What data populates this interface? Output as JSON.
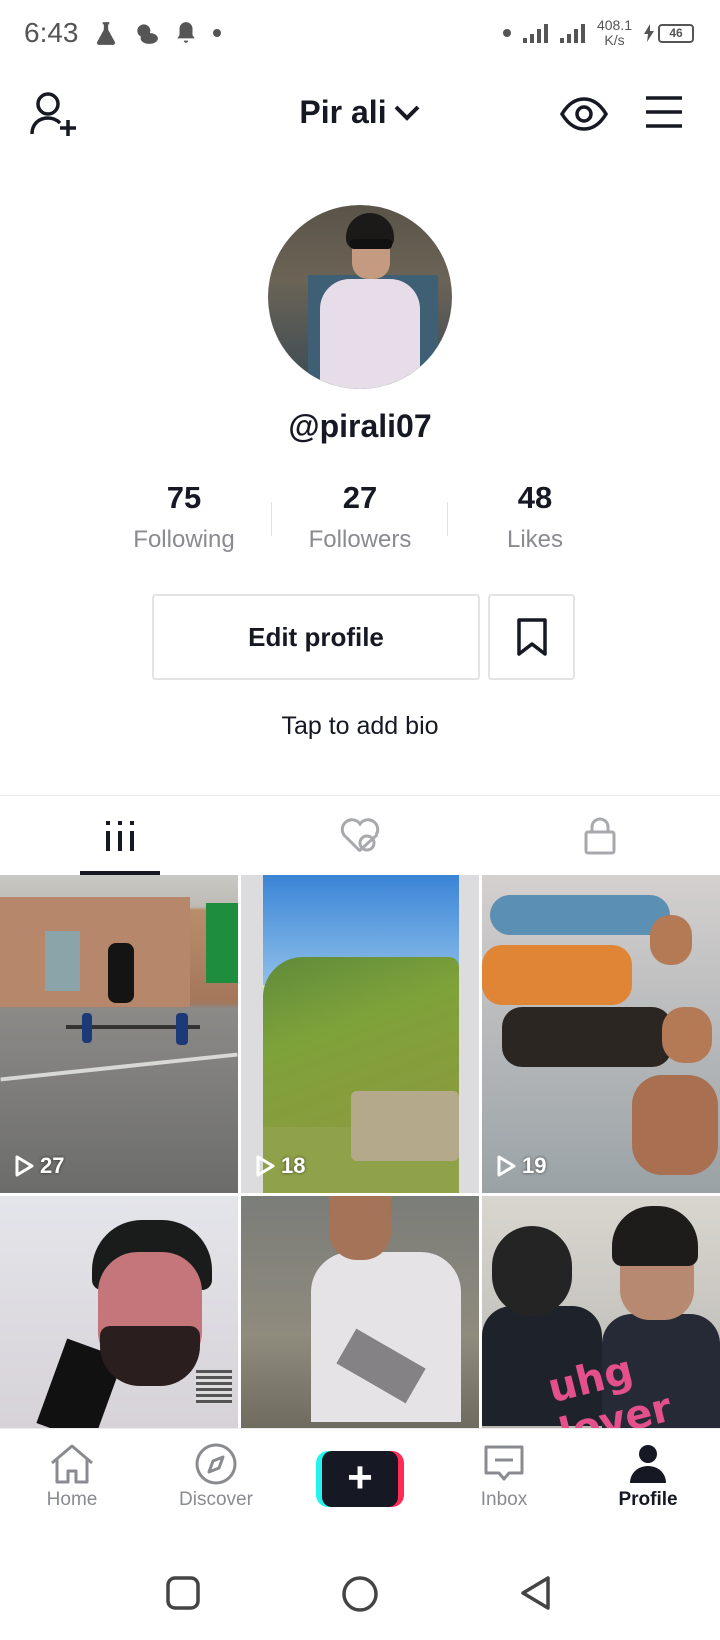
{
  "status_bar": {
    "time": "6:43",
    "net_speed_value": "408.1",
    "net_speed_unit": "K/s",
    "battery": "46"
  },
  "header": {
    "title": "Pir ali"
  },
  "profile": {
    "username": "@pirali07",
    "bio_placeholder": "Tap to add bio"
  },
  "stats": [
    {
      "value": "75",
      "label": "Following"
    },
    {
      "value": "27",
      "label": "Followers"
    },
    {
      "value": "48",
      "label": "Likes"
    }
  ],
  "actions": {
    "edit_label": "Edit profile"
  },
  "tabs": [
    {
      "icon": "grid-icon",
      "active": true
    },
    {
      "icon": "liked-hidden-icon",
      "active": false
    },
    {
      "icon": "lock-icon",
      "active": false
    }
  ],
  "videos": [
    {
      "views": "27"
    },
    {
      "views": "18"
    },
    {
      "views": "19"
    },
    {
      "views": ""
    },
    {
      "views": ""
    },
    {
      "views": "",
      "overlay_text": "uhg lover"
    }
  ],
  "bottom_nav": {
    "home": "Home",
    "discover": "Discover",
    "inbox": "Inbox",
    "profile": "Profile"
  },
  "colors": {
    "text_primary": "#161823",
    "text_secondary": "#8a8b91",
    "create_cyan": "#25f4ee",
    "create_pink": "#fe2c55"
  }
}
